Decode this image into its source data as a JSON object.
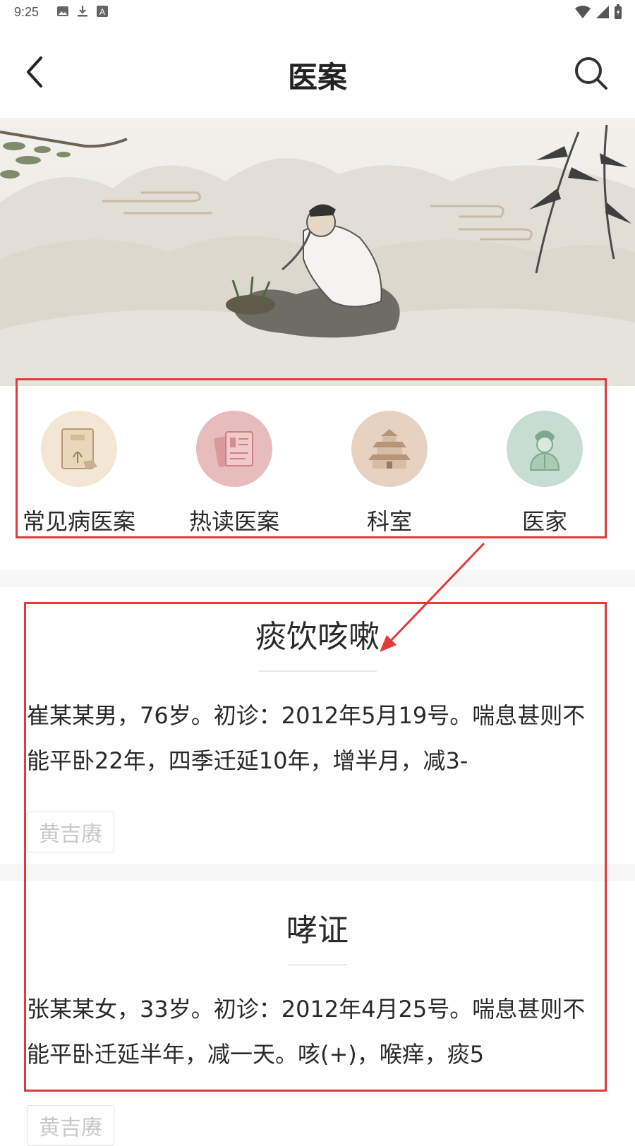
{
  "status_bar": {
    "time": "9:25",
    "left_icons": [
      "image-icon",
      "download-icon",
      "text-icon"
    ],
    "right_icons": [
      "wifi-icon",
      "signal-icon",
      "battery-icon"
    ]
  },
  "app_bar": {
    "title": "医案",
    "back_icon": "chevron-left-icon",
    "search_icon": "search-icon"
  },
  "banner": {
    "description_icon": "scholar-painting-image"
  },
  "categories": [
    {
      "label": "常见病医案",
      "icon": "book-icon",
      "color": "#f4e6d4"
    },
    {
      "label": "热读医案",
      "icon": "documents-icon",
      "color": "#e6bcbc"
    },
    {
      "label": "科室",
      "icon": "pagoda-icon",
      "color": "#e7d2c2"
    },
    {
      "label": "医家",
      "icon": "doctor-icon",
      "color": "#c8ddd1"
    }
  ],
  "cases": [
    {
      "title": "痰饮咳嗽",
      "summary": "崔某某男，76岁。初诊：2012年5月19号。喘息甚则不能平卧22年，四季迁延10年，增半月，减3-",
      "tag": "黄吉赓"
    },
    {
      "title": "哮证",
      "summary": "张某某女，33岁。初诊：2012年4月25号。喘息甚则不能平卧迁延半年，减一天。咳(+)，喉痒，痰5",
      "tag": "黄吉赓"
    }
  ],
  "annotation_color": "#e03a3a"
}
